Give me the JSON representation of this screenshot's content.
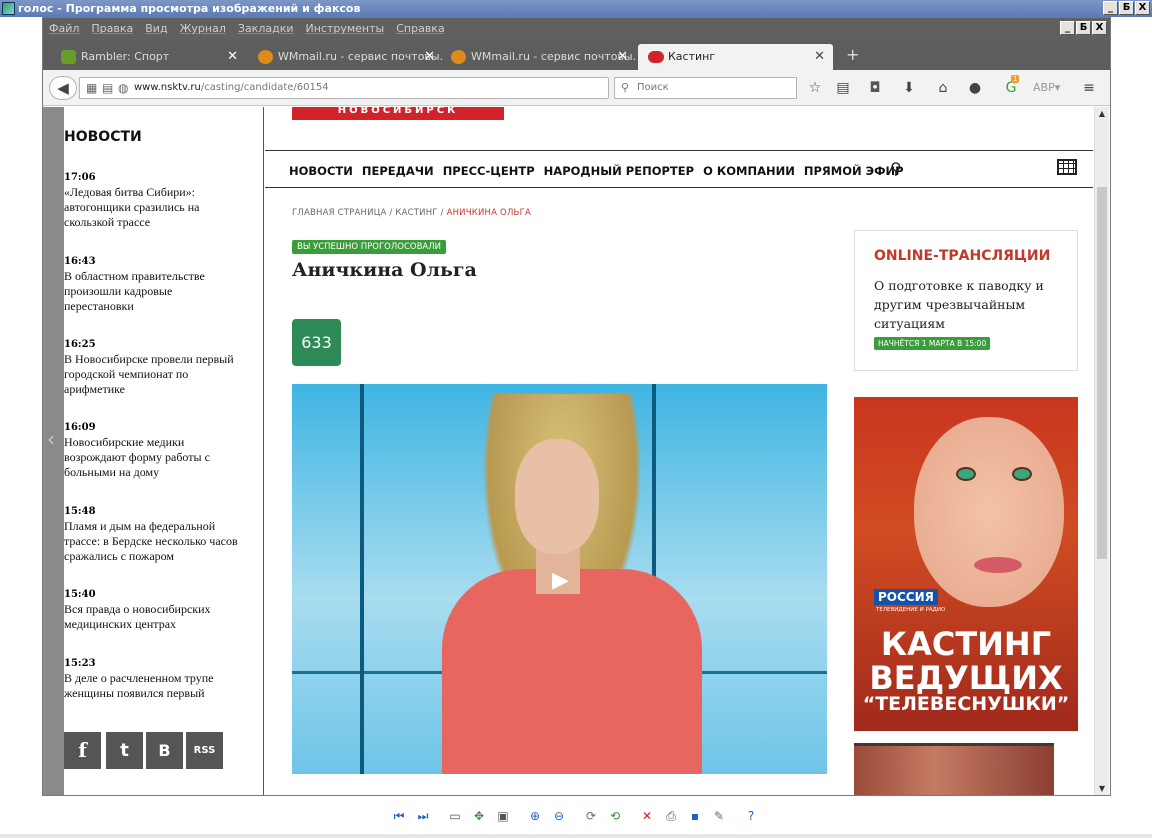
{
  "viewer": {
    "title": "голос - Программа просмотра изображений и факсов",
    "win_min": "_",
    "win_max": "Б",
    "win_close": "X"
  },
  "firefox": {
    "menu": [
      "Файл",
      "Правка",
      "Вид",
      "Журнал",
      "Закладки",
      "Инструменты",
      "Справка"
    ],
    "tabs": [
      {
        "label": "Rambler: Спорт",
        "icon_color": "#6a9c2a"
      },
      {
        "label": "WMmail.ru - сервис почтовы...",
        "icon_color": "#e08a1e"
      },
      {
        "label": "WMmail.ru - сервис почтовы...",
        "icon_color": "#e08a1e"
      },
      {
        "label": "Кастинг",
        "icon_color": "#d2232a"
      }
    ],
    "tab_close": "✕",
    "newtab": "+",
    "url_host": "www.nsktv.ru",
    "url_path": "/casting/candidate/60154",
    "search_placeholder": "Поиск",
    "addon_badge": "1"
  },
  "site": {
    "logo_text": "НОВОСИБИРСК",
    "nav": [
      "НОВОСТИ",
      "ПЕРЕДАЧИ",
      "ПРЕСС-ЦЕНТР",
      "НАРОДНЫЙ РЕПОРТЕР",
      "О КОМПАНИИ",
      "ПРЯМОЙ ЭФИР"
    ],
    "breadcrumbs": {
      "home": "ГЛАВНАЯ СТРАНИЦА",
      "sep": "/",
      "section": "КАСТИНГ",
      "current": "АНИЧКИНА ОЛЬГА"
    },
    "voted_badge": "ВЫ УСПЕШНО ПРОГОЛОСОВАЛИ",
    "candidate_name": "Аничкина Ольга",
    "votes": "633",
    "online": {
      "title": "ONLINE-ТРАНСЛЯЦИИ",
      "text": "О подготовке к паводку и другим чрезвычайным ситуациям",
      "badge": "НАЧНЁТСЯ 1 МАРТА В 15:00"
    },
    "banner": {
      "brand": "РОССИЯ",
      "brand_sub": "ТЕЛЕВИДЕНИЕ И РАДИО",
      "line1": "КАСТИНГ",
      "line2": "ВЕДУЩИХ",
      "line3": "“ТЕЛЕВЕСНУШКИ”"
    }
  },
  "sidebar": {
    "heading": "НОВОСТИ",
    "items": [
      {
        "time": "17:06",
        "text": "«Ледовая битва Сибири»: автогонщики сразились на скользкой трассе"
      },
      {
        "time": "16:43",
        "text": "В областном правительстве произошли кадровые перестановки"
      },
      {
        "time": "16:25",
        "text": "В Новосибирске провели первый городской чемпионат по арифметике"
      },
      {
        "time": "16:09",
        "text": "Новосибирские медики возрождают форму работы с больными на дому"
      },
      {
        "time": "15:48",
        "text": "Пламя и дым на федеральной трассе: в Бердске несколько часов сражались с пожаром"
      },
      {
        "time": "15:40",
        "text": "Вся правда о новосибирских медицинских центрах"
      },
      {
        "time": "15:23",
        "text": "В деле о расчлененном трупе женщины появился первый"
      }
    ],
    "social": {
      "facebook": "f",
      "twitter": "t",
      "vk": "В",
      "rss": "RSS"
    }
  }
}
